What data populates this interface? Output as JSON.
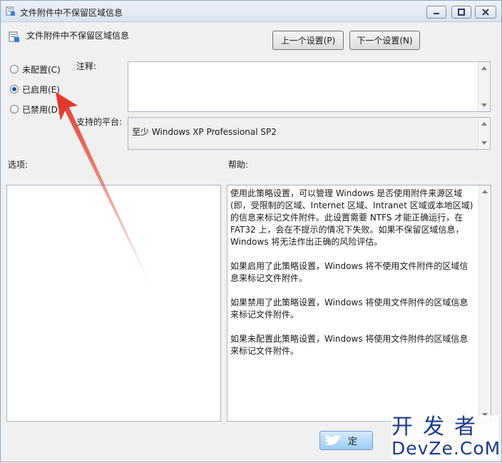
{
  "window": {
    "title": "文件附件中不保留区域信息",
    "header_title": "文件附件中不保留区域信息"
  },
  "nav": {
    "prev_label": "上一个设置(P)",
    "next_label": "下一个设置(N)"
  },
  "state": {
    "options": [
      {
        "label": "未配置(C)",
        "selected": false
      },
      {
        "label": "已启用(E)",
        "selected": true
      },
      {
        "label": "已禁用(D)",
        "selected": false
      }
    ]
  },
  "comment": {
    "label": "注释:",
    "value": ""
  },
  "platform": {
    "label": "支持的平台:",
    "value": "至少 Windows XP Professional SP2"
  },
  "options_section": {
    "label": "选项:"
  },
  "help_section": {
    "label": "帮助:",
    "paragraphs": [
      "使用此策略设置，可以管理 Windows 是否使用附件来源区域(即，受限制的区域、Internet 区域、Intranet 区域或本地区域)的信息来标记文件附件。此设置需要 NTFS 才能正确运行，在 FAT32 上，会在不提示的情况下失败。如果不保留区域信息，Windows 将无法作出正确的风险评估。",
      "如果启用了此策略设置，Windows 将不使用文件附件的区域信息来标记文件附件。",
      "如果禁用了此策略设置，Windows 将使用文件附件的区域信息来标记文件附件。",
      "如果未配置此策略设置，Windows 将使用文件附件的区域信息来标记文件附件。"
    ]
  },
  "footer": {
    "ok_partial": "定"
  },
  "watermark": {
    "cn": "开发者",
    "en": "DevZe.CoM"
  },
  "colors": {
    "annotation_arrow": "#e03a2c",
    "radio_dot": "#1f4e9c",
    "watermark": "#1b3a8a"
  }
}
